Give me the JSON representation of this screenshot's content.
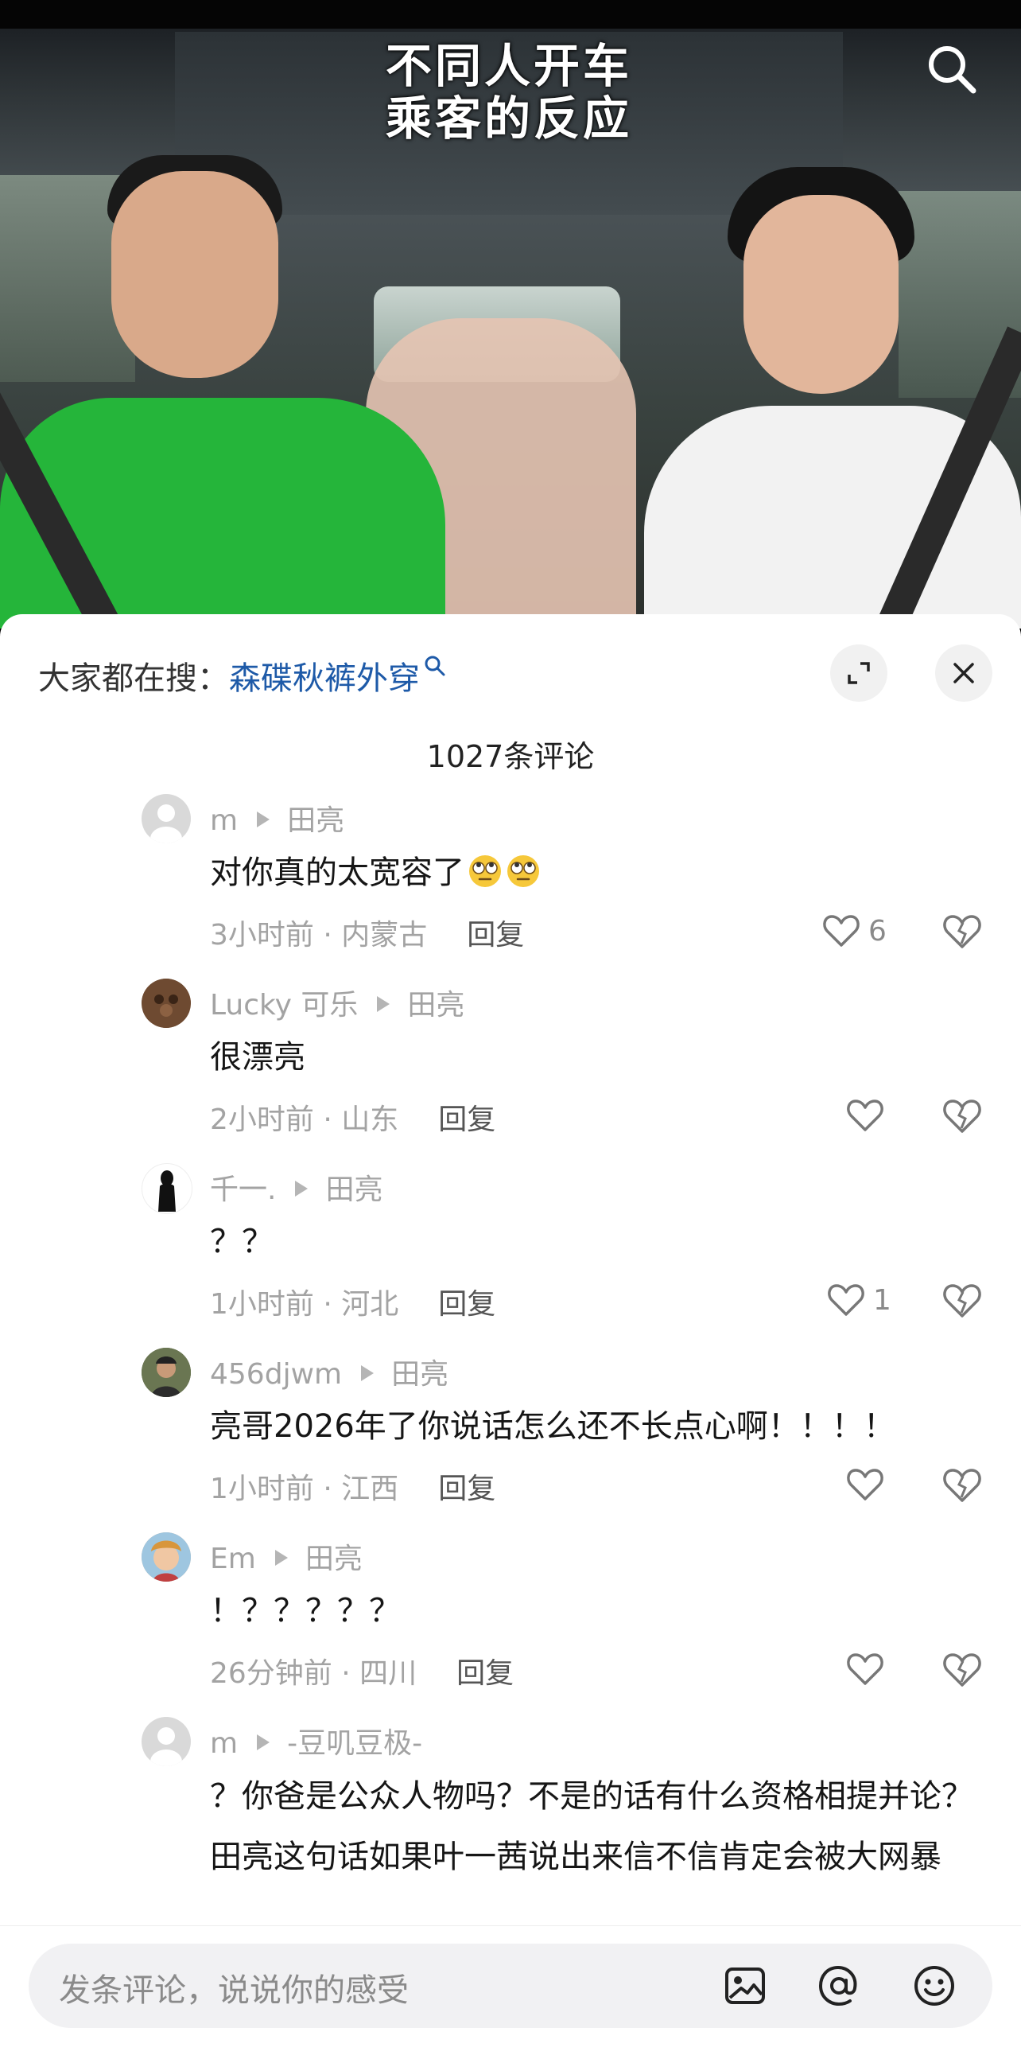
{
  "video": {
    "title_line1": "不同人开车",
    "title_line2": "乘客的反应"
  },
  "trending": {
    "label": "大家都在搜：",
    "keyword": "森碟秋裤外穿"
  },
  "comment_count": "1027条评论",
  "comments": [
    {
      "user": "m",
      "reply_to": "田亮",
      "text": "对你真的太宽容了",
      "time_loc": "3小时前 · 内蒙古",
      "reply": "回复",
      "likes": "6",
      "avatar_color": "#d6d6d6"
    },
    {
      "user": "Lucky 可乐",
      "reply_to": "田亮",
      "text": "很漂亮",
      "time_loc": "2小时前 · 山东",
      "reply": "回复",
      "likes": "",
      "avatar_color": "#6b4a33"
    },
    {
      "user": "千一.",
      "reply_to": "田亮",
      "text": "？？",
      "time_loc": "1小时前 · 河北",
      "reply": "回复",
      "likes": "1",
      "avatar_color": "#ffffff"
    },
    {
      "user": "456djwm",
      "reply_to": "田亮",
      "text": "亮哥2026年了你说话怎么还不长点心啊！！！！",
      "time_loc": "1小时前 · 江西",
      "reply": "回复",
      "likes": "",
      "avatar_color": "#4d5a3e"
    },
    {
      "user": "Em",
      "reply_to": "田亮",
      "text": "！？？？？？",
      "time_loc": "26分钟前 · 四川",
      "reply": "回复",
      "likes": "",
      "avatar_color": "#e7b78f"
    },
    {
      "user": "m",
      "reply_to": "-豆叽豆极-",
      "text": "？你爸是公众人物吗？不是的话有什么资格相提并论？田亮这句话如果叶一茜说出来信不信肯定会被大网暴",
      "time_loc": "",
      "reply": "",
      "likes": "",
      "avatar_color": "#d6d6d6"
    }
  ],
  "input": {
    "placeholder": "发条评论，说说你的感受"
  },
  "icons": {
    "search": "search-icon",
    "expand": "expand-icon",
    "close": "close-icon",
    "like": "heart-icon",
    "dislike": "broken-heart-icon",
    "image": "image-icon",
    "mention": "at-icon",
    "emoji": "emoji-icon",
    "eye_roll": "eye-roll-emoji"
  }
}
